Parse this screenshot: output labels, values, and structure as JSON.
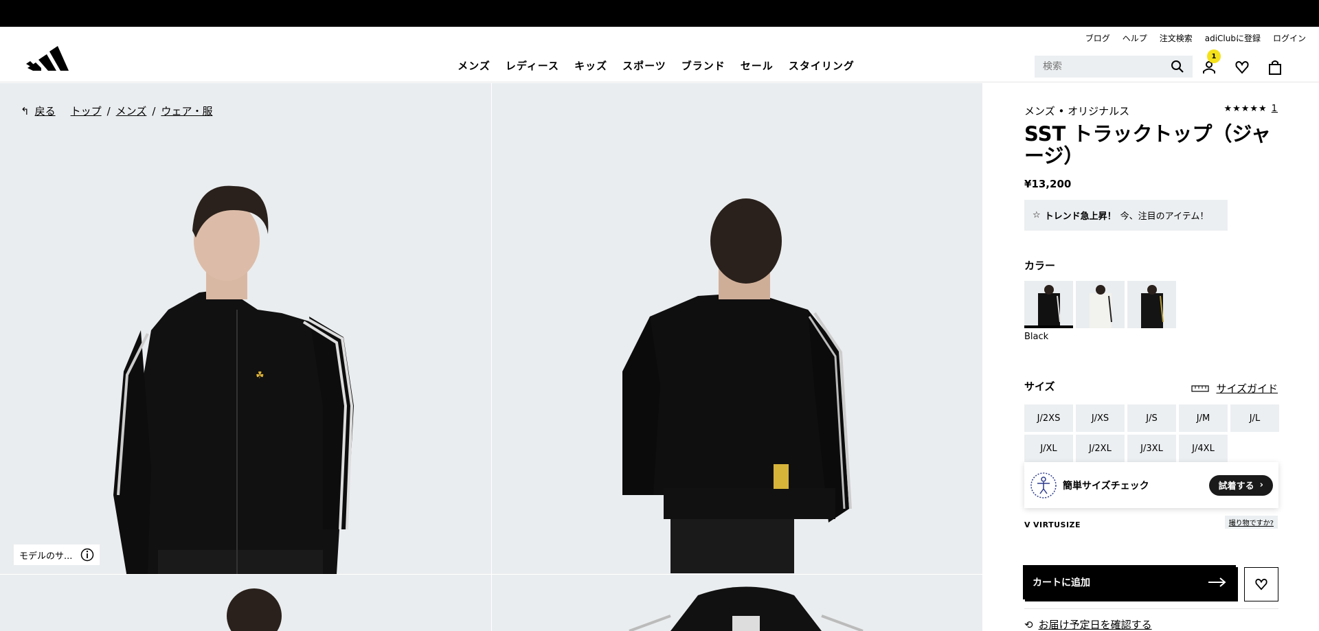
{
  "header": {
    "utility_links": [
      "ブログ",
      "ヘルプ",
      "注文検索",
      "adiClubに登録",
      "ログイン"
    ],
    "nav": [
      "メンズ",
      "レディース",
      "キッズ",
      "スポーツ",
      "ブランド",
      "セール",
      "スタイリング"
    ],
    "search_placeholder": "検索",
    "account_badge": "1",
    "icons": [
      "adidas-logo-icon",
      "search-icon",
      "account-icon",
      "wishlist-icon",
      "bag-icon"
    ]
  },
  "breadcrumb": {
    "back": "戻る",
    "items": [
      "トップ",
      "メンズ",
      "ウェア・服"
    ],
    "separator": "/"
  },
  "gallery": {
    "model_info": "モデルのサ..."
  },
  "product": {
    "category": "メンズ • オリジナルス",
    "stars": "★★★★★",
    "review_count": "1",
    "title": "SST トラックトップ（ジャージ）",
    "price": "¥13,200",
    "trend_bold": "トレンド急上昇！",
    "trend_text": "今、注目のアイテム！",
    "color_heading": "カラー",
    "selected_color": "Black",
    "size_heading": "サイズ",
    "size_guide": "サイズガイド",
    "sizes": [
      "J/2XS",
      "J/XS",
      "J/S",
      "J/M",
      "J/L",
      "J/XL",
      "J/2XL",
      "J/3XL",
      "J/4XL"
    ],
    "virtusize_text": "簡単サイズチェック",
    "virtusize_button": "試着する",
    "virtusize_logo": "VIRTUSIZE",
    "virtusize_help": "撮り物ですか?",
    "add_to_cart": "カートに追加",
    "delivery": "お届け予定日を確認する"
  },
  "colors": {
    "background": "#eaedef",
    "badge": "#f5e11a",
    "jacket": "#0b0b0b"
  }
}
